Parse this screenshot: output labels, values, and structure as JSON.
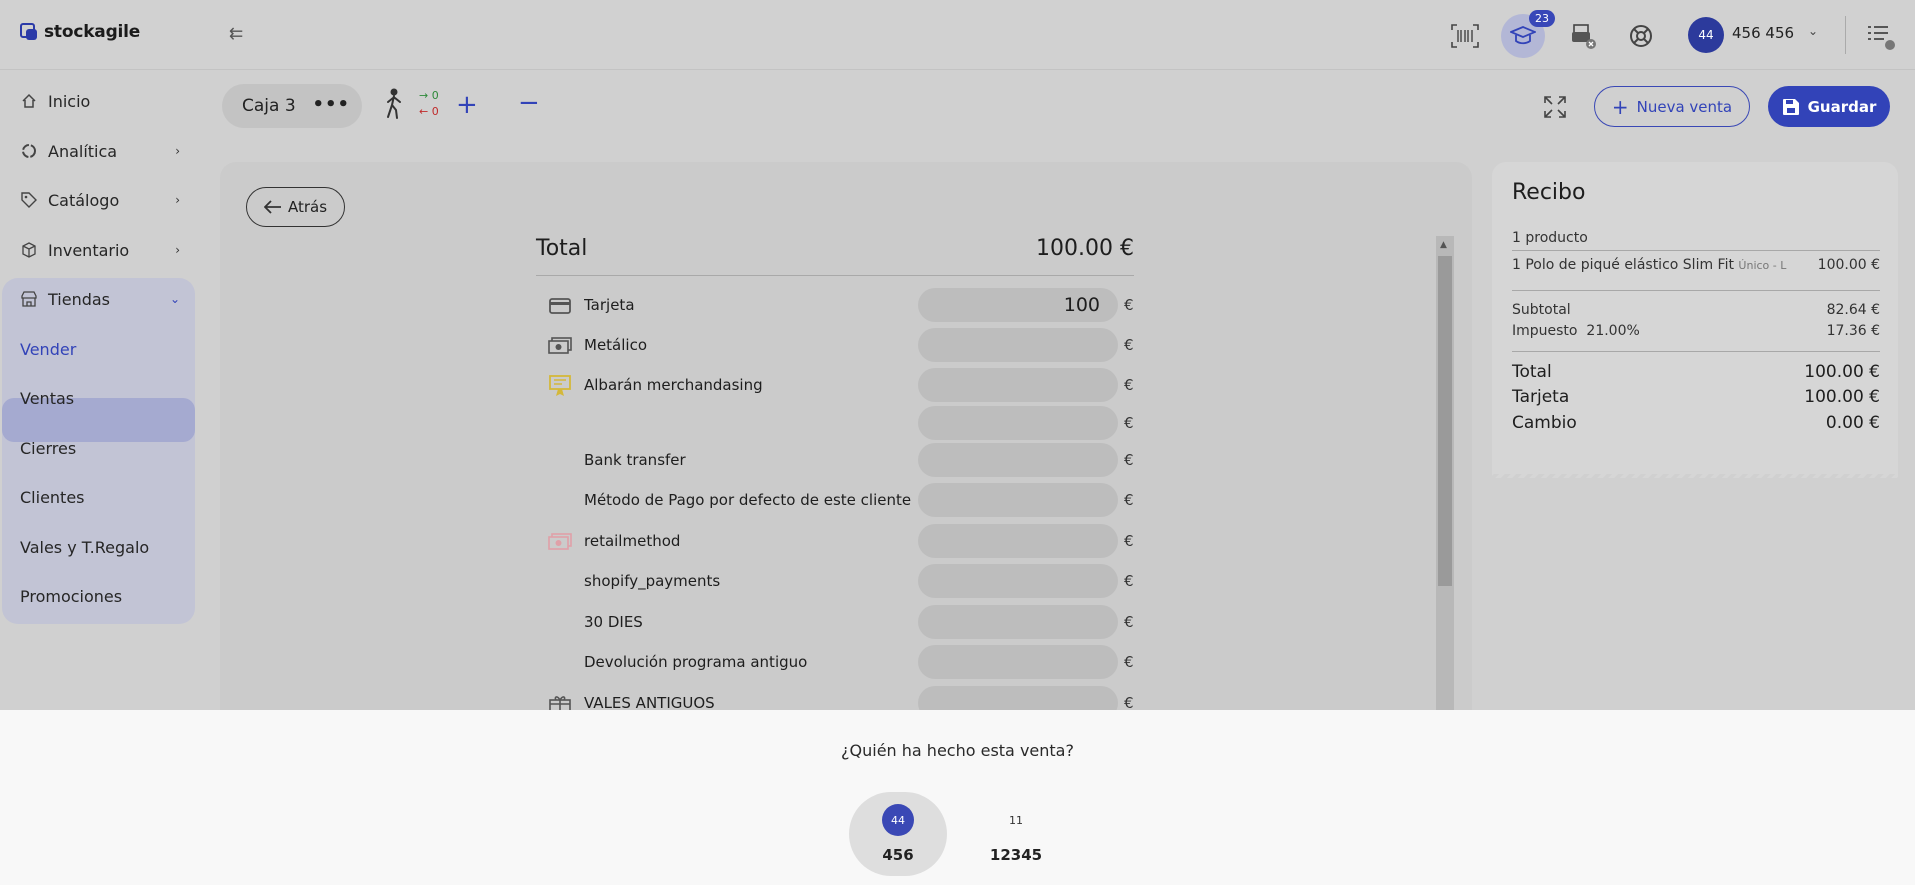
{
  "header": {
    "logo_text": "stockagile",
    "notifications_count": "23",
    "user_initials": "44",
    "user_name": "456 456"
  },
  "sidebar": {
    "items": [
      {
        "label": "Inicio",
        "icon": "home-icon"
      },
      {
        "label": "Analítica",
        "icon": "analytics-icon"
      },
      {
        "label": "Catálogo",
        "icon": "tag-icon"
      },
      {
        "label": "Inventario",
        "icon": "box-icon"
      },
      {
        "label": "Tiendas",
        "icon": "store-icon"
      }
    ],
    "tiendas_sub": [
      "Vender",
      "Ventas",
      "Cierres",
      "Clientes",
      "Vales y T.Regalo",
      "Promociones"
    ],
    "active": "Vender"
  },
  "toolbar": {
    "caja_label": "Caja 3",
    "count_in": "0",
    "count_out": "0",
    "nueva_venta_label": "Nueva venta",
    "guardar_label": "Guardar"
  },
  "payment": {
    "back_label": "Atrás",
    "total_label": "Total",
    "total_value": "100.00 €",
    "currency": "€",
    "methods": [
      {
        "label": "Tarjeta",
        "value": "100",
        "icon": "card-icon"
      },
      {
        "label": "Metálico",
        "value": "",
        "icon": "cash-icon"
      },
      {
        "label": "Albarán merchandasing",
        "value": "",
        "icon": "certificate-icon"
      },
      {
        "label": "",
        "value": "",
        "icon": ""
      },
      {
        "label": "Bank transfer",
        "value": "",
        "icon": ""
      },
      {
        "label": "Método de Pago por defecto de este cliente",
        "value": "",
        "icon": ""
      },
      {
        "label": "retailmethod",
        "value": "",
        "icon": "cash-pink-icon"
      },
      {
        "label": "shopify_payments",
        "value": "",
        "icon": ""
      },
      {
        "label": "30 DIES",
        "value": "",
        "icon": ""
      },
      {
        "label": "Devolución programa antiguo",
        "value": "",
        "icon": ""
      },
      {
        "label": "VALES ANTIGUOS",
        "value": "",
        "icon": "gift-icon"
      }
    ]
  },
  "receipt": {
    "title": "Recibo",
    "product_count": "1 producto",
    "item_name": "1 Polo de piqué elástico Slim Fit",
    "item_variant": "Único - L",
    "item_price": "100.00 €",
    "subtotal_label": "Subtotal",
    "subtotal_value": "82.64 €",
    "tax_label": "Impuesto",
    "tax_rate": "21.00%",
    "tax_value": "17.36 €",
    "total_label": "Total",
    "total_value": "100.00 €",
    "card_label": "Tarjeta",
    "card_value": "100.00 €",
    "change_label": "Cambio",
    "change_value": "0.00 €"
  },
  "seller_prompt": {
    "question": "¿Quién ha hecho esta venta?",
    "sellers": [
      {
        "initials": "44",
        "name": "456",
        "selected": true
      },
      {
        "initials": "11",
        "name": "12345",
        "selected": false
      }
    ]
  },
  "colors": {
    "accent": "#3243b8",
    "sidebar_active": "#a5aad0"
  }
}
